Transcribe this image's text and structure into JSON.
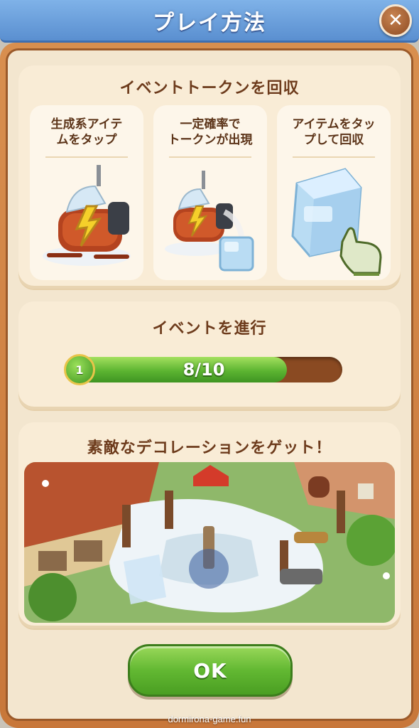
{
  "header": {
    "title": "プレイ方法",
    "close_label": "✕"
  },
  "section_collect": {
    "title": "イベントトークンを回収",
    "steps": [
      {
        "label": "生成系アイテ\nムをタップ",
        "art": "snowmobile-with-lightning"
      },
      {
        "label": "一定確率で\nトークンが出現",
        "art": "snowmobile-with-ice-cube"
      },
      {
        "label": "アイテムをタッ\nプして回収",
        "art": "ice-cube-with-glove-hand"
      }
    ]
  },
  "section_progress": {
    "title": "イベントを進行",
    "level": "1",
    "progress_text": "8/10",
    "progress_value": 8,
    "progress_max": 10
  },
  "section_reward": {
    "title": "素敵なデコレーションをゲット！",
    "image": "winter-village-decoration-scene"
  },
  "footer": {
    "ok_label": "OK",
    "watermark": "dormirona-game.fun"
  },
  "colors": {
    "title_bar": "#5a8fd0",
    "frame": "#c8773a",
    "panel": "#f9ecd6",
    "title_text": "#6d3b1c",
    "progress_green": "#5cb431",
    "ok_green": "#62b832"
  }
}
